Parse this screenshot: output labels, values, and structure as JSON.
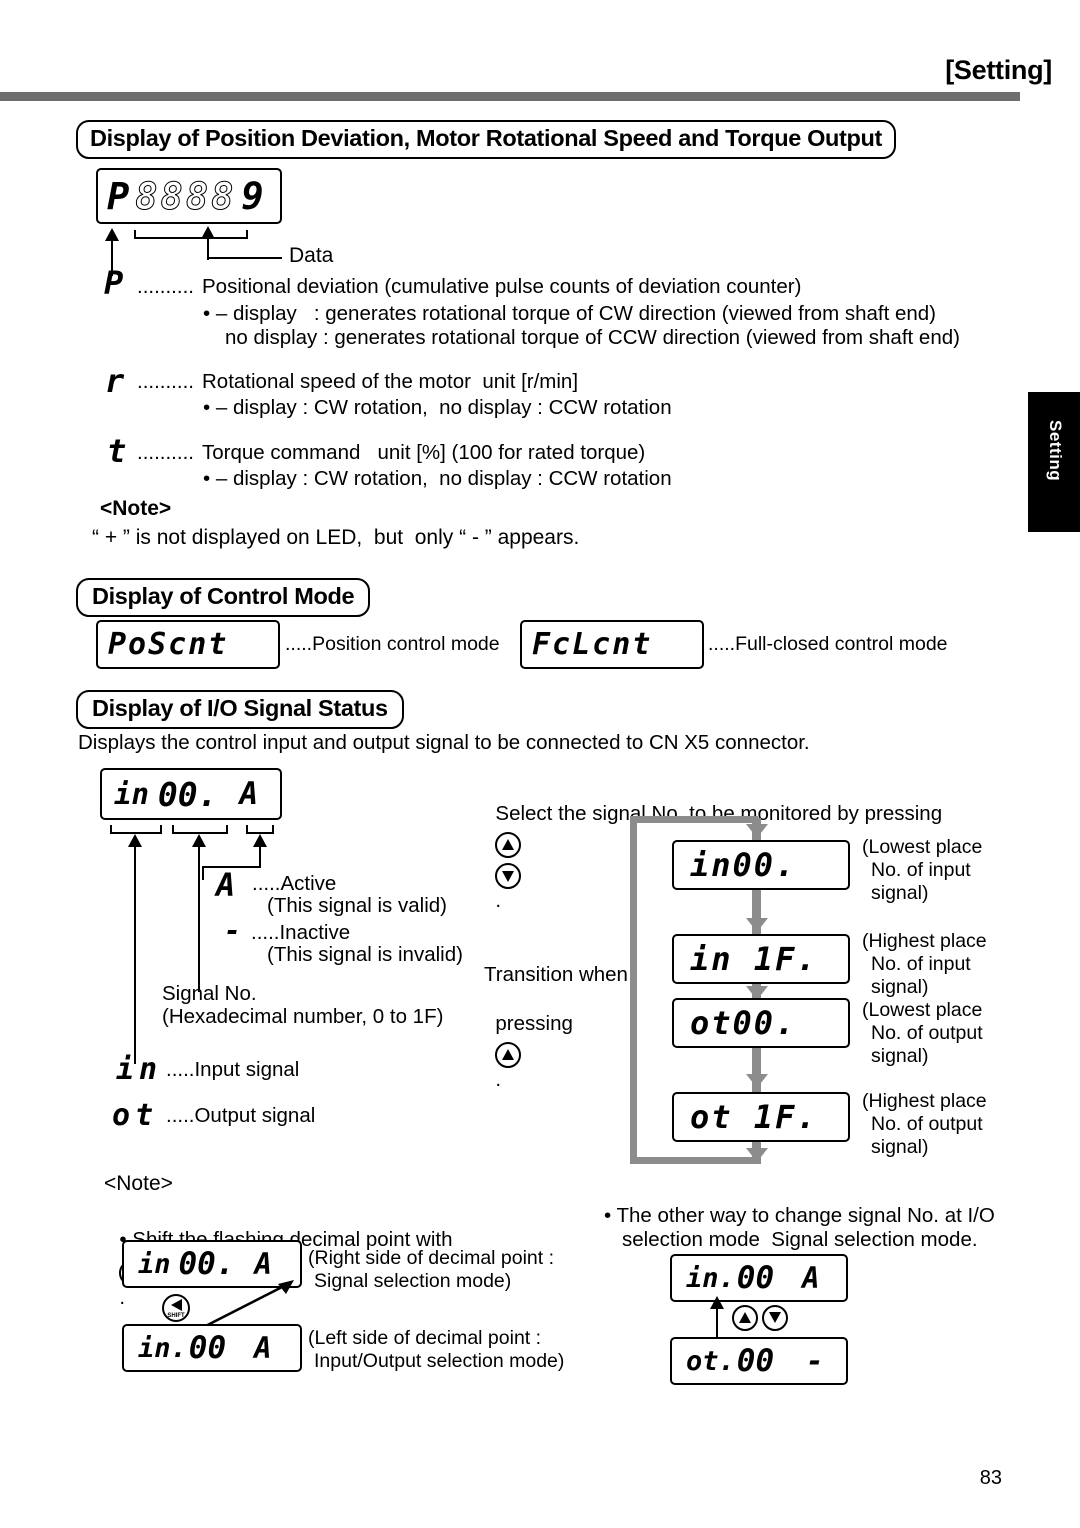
{
  "header": {
    "title": "[Setting]"
  },
  "side_tab": {
    "label": "Setting"
  },
  "page_number": "83",
  "sections": {
    "s1": {
      "heading": "Display of Position Deviation, Motor Rotational Speed and Torque Output"
    },
    "s2": {
      "heading": "Display of Control Mode"
    },
    "s3": {
      "heading": "Display of I/O Signal Status"
    }
  },
  "top_display": {
    "prefix": "P",
    "digits": "8888",
    "last_digit": "9",
    "data_label": "Data"
  },
  "legend": {
    "p_symbol": "P",
    "p_dots": "..........",
    "p_text": "Positional deviation (cumulative pulse counts of deviation counter)",
    "p_sub1": "• – display   : generates rotational torque of CW direction (viewed from shaft end)",
    "p_sub2": "no display : generates rotational torque of CCW direction (viewed from shaft end)",
    "r_symbol": "r",
    "r_dots": "..........",
    "r_text": "Rotational speed of the motor  unit [r/min]",
    "r_sub1": "• – display : CW rotation,  no display : CCW rotation",
    "t_symbol": "t",
    "t_dots": "..........",
    "t_text": "Torque command   unit [%] (100 for rated torque)",
    "t_sub1": "• – display : CW rotation,  no display : CCW rotation"
  },
  "note1": {
    "title": "<Note>",
    "body": "“ + ” is not displayed on LED,  but  only “ - ” appears."
  },
  "control_mode": {
    "pos_led": "PoScnt",
    "pos_text": ".....Position control mode",
    "fcl_led": "FcLcnt",
    "fcl_text": ".....Full-closed control mode"
  },
  "io_status": {
    "intro": "Displays the control input and output signal to be connected to CN X5 connector.",
    "main_led_prefix": "in",
    "main_led_num": "00.",
    "main_led_state": "A",
    "active_symbol": "A",
    "active_text": ".....Active",
    "active_sub": "(This signal is valid)",
    "inactive_symbol": "-",
    "inactive_text": ".....Inactive",
    "inactive_sub": "(This signal is invalid)",
    "signal_no_line1": "Signal No.",
    "signal_no_line2": "(Hexadecimal number, 0 to 1F)",
    "in_symbol": "in",
    "in_text": ".....Input signal",
    "ot_symbol": "ot",
    "ot_text": ".....Output signal"
  },
  "transition": {
    "select_text_a": "Select the signal No. to be monitored by pressing",
    "select_text_b": ".",
    "transition_line1": "Transition when",
    "transition_line2a": "pressing",
    "transition_line2b": ".",
    "steps": [
      {
        "led": "in00.",
        "label1": "(Lowest place",
        "label2": "No. of input",
        "label3": "signal)"
      },
      {
        "led": "in 1F.",
        "label1": "(Highest place",
        "label2": "No. of input",
        "label3": "signal)"
      },
      {
        "led": "ot00.",
        "label1": "(Lowest place",
        "label2": "No. of output",
        "label3": "signal)"
      },
      {
        "led": "ot 1F.",
        "label1": "(Highest place",
        "label2": "No. of output",
        "label3": "signal)"
      }
    ]
  },
  "note2": {
    "title": "<Note>",
    "bullet1a": "• Shift the flashing decimal point with",
    "bullet1b": ".",
    "disp_right": {
      "prefix": "in",
      "num": "00.",
      "state": "A"
    },
    "disp_right_text1": "(Right side of decimal point :",
    "disp_right_text2": "Signal selection mode)",
    "disp_left": {
      "prefix": "in.",
      "num": "00",
      "state": "A"
    },
    "disp_left_text1": "(Left side of decimal point :",
    "disp_left_text2": "Input/Output selection mode)",
    "bullet2_line1": "• The other way to change signal No. at I/O",
    "bullet2_line2": "selection mode  Signal selection mode.",
    "alt_top": {
      "prefix": "in.",
      "num": "00",
      "state": "A"
    },
    "alt_bottom": {
      "prefix": "ot.",
      "num": "00",
      "state": "-"
    }
  },
  "icons": {
    "up_key": "up-arrow-key",
    "down_key": "down-arrow-key",
    "shift_key": "shift-key",
    "shift_label": "SHIFT"
  }
}
